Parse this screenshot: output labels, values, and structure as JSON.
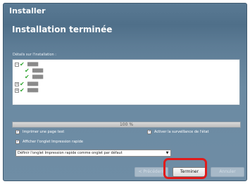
{
  "window": {
    "title": "Installer"
  },
  "page": {
    "title": "Installation terminée"
  },
  "details": {
    "label": "Détails sur l'installation :",
    "items": [
      {
        "text": "█████",
        "expander": "−",
        "checked": true,
        "level": 0
      },
      {
        "text": "█████",
        "expander": "",
        "checked": true,
        "level": 1
      },
      {
        "text": "█████",
        "expander": "",
        "checked": true,
        "level": 1
      },
      {
        "text": "█████",
        "expander": "+",
        "checked": true,
        "level": 0
      },
      {
        "text": "█████",
        "expander": "+",
        "checked": true,
        "level": 0
      }
    ]
  },
  "progress": {
    "value": 1.0,
    "label": "100 %"
  },
  "options": {
    "print_test_page": {
      "label": "Imprimer une page test",
      "checked": true
    },
    "activate_monitoring": {
      "label": "Activer la surveillance de l'état",
      "checked": true
    },
    "show_quick_print_tab": {
      "label": "Afficher l'onglet Impression rapide",
      "checked": true
    },
    "default_tab_select": {
      "value": "Définir l'onglet Impression rapide comme onglet par défaut"
    }
  },
  "buttons": {
    "previous": "< Précédent",
    "finish": "Terminer",
    "cancel": "Annuler"
  },
  "colors": {
    "highlight": "#e01b1b",
    "check": "#2fa52f"
  }
}
